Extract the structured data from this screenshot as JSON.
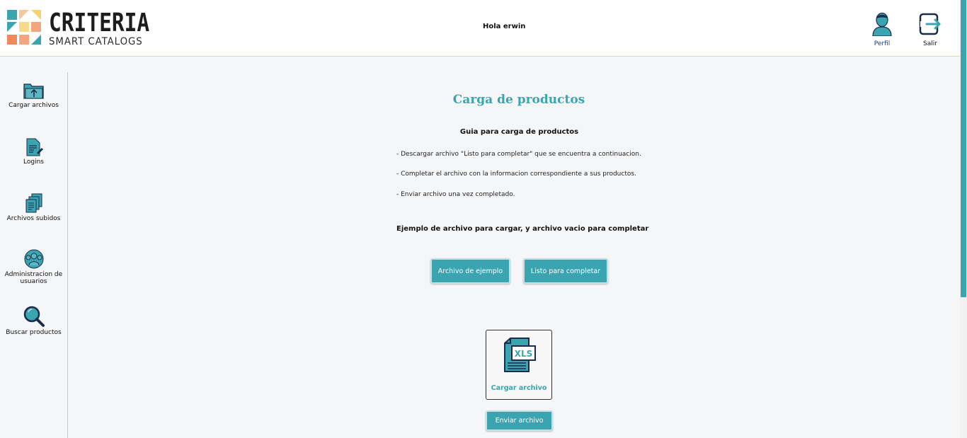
{
  "header": {
    "logo_name": "CRITERIA",
    "logo_sub": "SMART CATALOGS",
    "greeting": "Hola erwin",
    "profile_label": "Perfil",
    "logout_label": "Salir"
  },
  "sidebar": {
    "items": [
      {
        "label": "Cargar archivos",
        "icon": "folder-upload-icon"
      },
      {
        "label": "Logins",
        "icon": "document-edit-icon"
      },
      {
        "label": "Archivos subidos",
        "icon": "stacked-documents-icon"
      },
      {
        "label": "Administracion de usuarios",
        "icon": "users-group-icon"
      },
      {
        "label": "Buscar productos",
        "icon": "magnifier-icon"
      }
    ]
  },
  "main": {
    "title": "Carga de productos",
    "guide_title": "Guia para carga de productos",
    "guide_lines": [
      "- Descargar archivo \"Listo para completar\" que se encuentra a continuacion.",
      "- Completar el archivo con la informacion correspondiente a sus productos.",
      "- Enviar archivo una vez completado."
    ],
    "example_title": "Ejemplo de archivo para cargar, y archivo vacio para completar",
    "example_button": "Archivo de ejemplo",
    "template_button": "Listo para completar",
    "upload_label": "Cargar archivo",
    "upload_icon_text": "XLS",
    "send_button": "Enviar archivo"
  },
  "colors": {
    "accent": "#3aa5b0",
    "header_border": "#f2d58a",
    "sidebar_border": "#f2c84b",
    "background": "#f5f6f8"
  }
}
